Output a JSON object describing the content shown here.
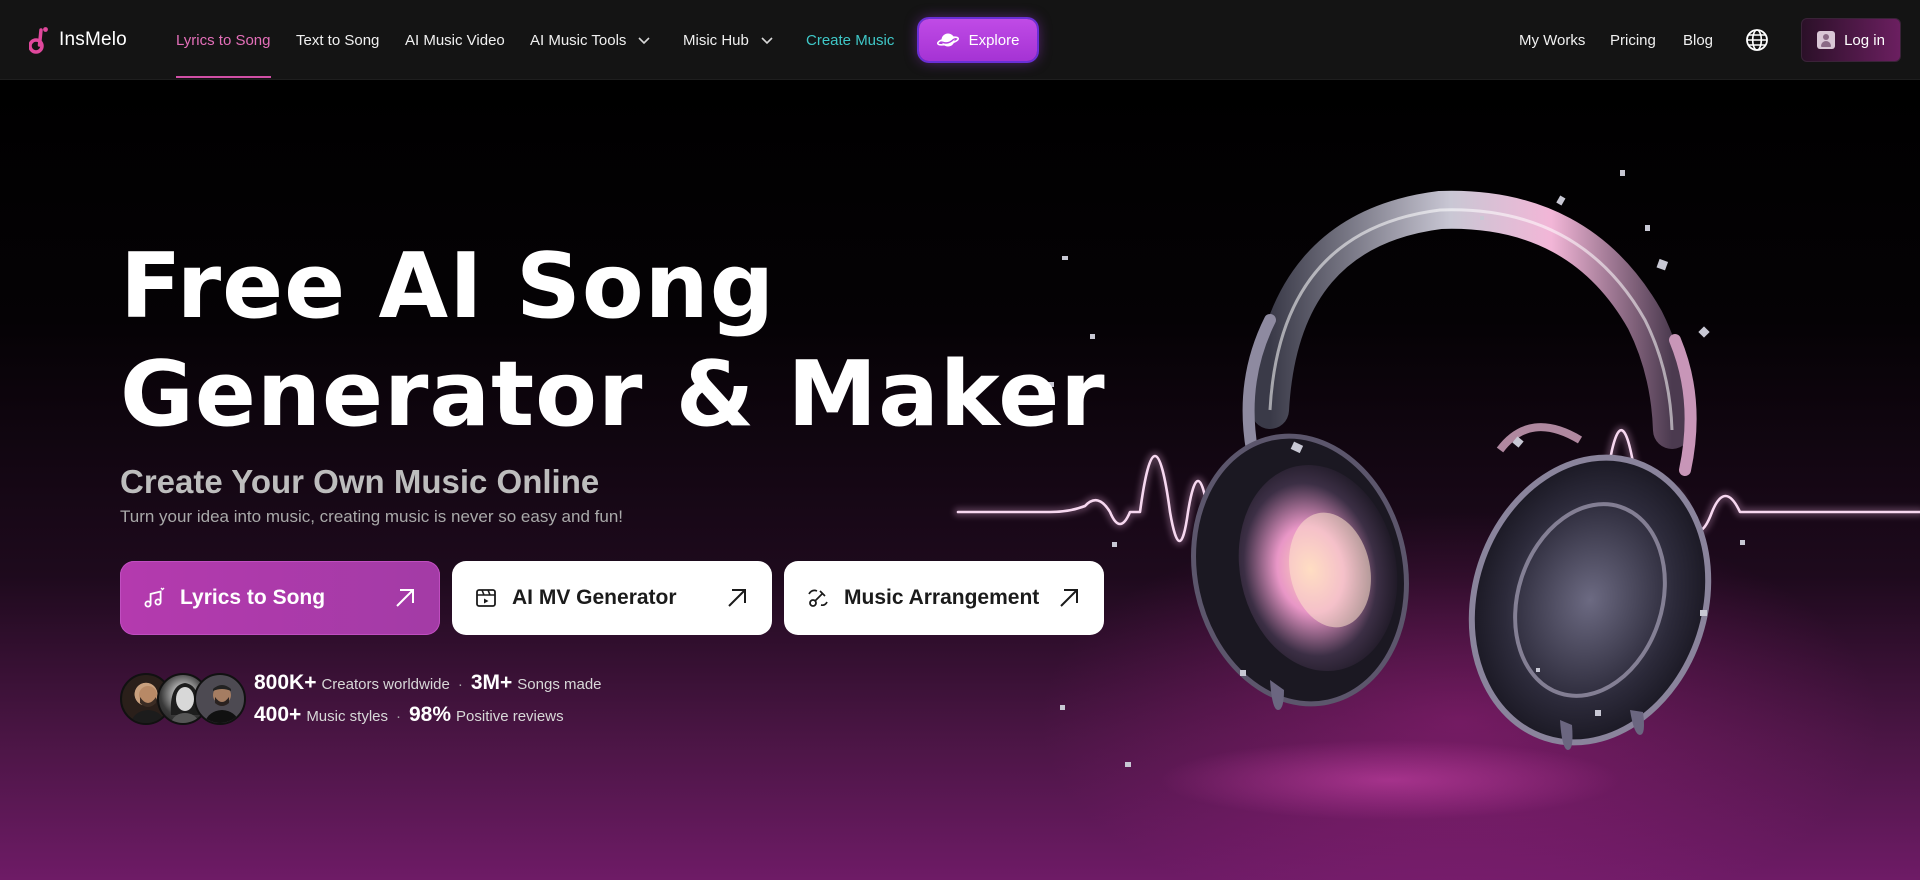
{
  "brand": {
    "name": "InsMelo"
  },
  "nav": {
    "items": [
      {
        "label": "Lyrics to Song",
        "active": true
      },
      {
        "label": "Text to Song"
      },
      {
        "label": "AI Music Video"
      },
      {
        "label": "AI Music Tools",
        "dropdown": true
      },
      {
        "label": "Misic Hub",
        "dropdown": true
      },
      {
        "label": "Create Music",
        "accent": "#3fc7c7"
      }
    ],
    "explore_label": "Explore",
    "right_links": [
      "My Works",
      "Pricing",
      "Blog"
    ],
    "language_icon": "globe-icon",
    "login_label": "Log in"
  },
  "hero": {
    "title_line1": "Free AI Song",
    "title_line2": "Generator & Maker",
    "subtitle": "Create Your Own Music Online",
    "description": "Turn your idea into music, creating music is never so easy and fun!",
    "ctas": [
      {
        "label": "Lyrics to Song",
        "icon": "music-note-icon"
      },
      {
        "label": "AI MV Generator",
        "icon": "video-clip-icon"
      },
      {
        "label": "Music Arrangement",
        "icon": "arrangement-icon"
      }
    ],
    "stats": {
      "creators_value": "800K+",
      "creators_label": "Creators worldwide",
      "songs_value": "3M+",
      "songs_label": "Songs made",
      "styles_value": "400+",
      "styles_label": "Music styles",
      "reviews_value": "98%",
      "reviews_label": "Positive reviews"
    }
  },
  "colors": {
    "accent_pink": "#d04fa6",
    "explore_purple": "#b13fe0",
    "create_music_teal": "#3fc7c7",
    "cta_primary": "#a93aaa"
  }
}
